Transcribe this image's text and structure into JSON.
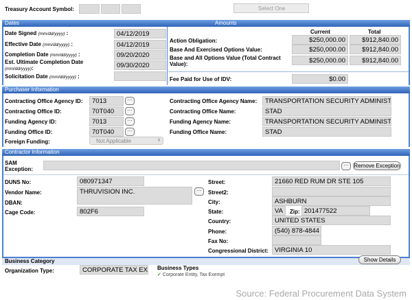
{
  "top": {
    "treasury_label": "Treasury Account Symbol:",
    "select_text": "Select One"
  },
  "dates": {
    "header": "Dates",
    "rows": [
      {
        "label": "Date Signed",
        "fmt": "(mm/dd/yyyy)",
        "suffix": " :",
        "value": "04/12/2019"
      },
      {
        "label": "Effective Date",
        "fmt": "(mm/dd/yyyy)",
        "suffix": " :",
        "value": "04/12/2019"
      },
      {
        "label": "Completion Date",
        "fmt": "(mm/dd/yyyy)",
        "suffix": " :",
        "value": "09/20/2020"
      },
      {
        "label": "Est. Ultimate Completion Date",
        "fmt": "(mm/dd/yyyy)",
        "suffix": ":",
        "value": "09/30/2020"
      },
      {
        "label": "Solicitation Date",
        "fmt": "(mm/dd/yyyy)",
        "suffix": " :",
        "value": ""
      }
    ]
  },
  "amounts": {
    "header": "Amounts",
    "col_current": "Current",
    "col_total": "Total",
    "rows": [
      {
        "label": "Action Obligation:",
        "current": "$250,000.00",
        "total": "$912,840.00"
      },
      {
        "label": "Base And Exercised Options Value:",
        "current": "$250,000.00",
        "total": "$912,840.00"
      },
      {
        "label": "Base and All Options Value (Total Contract Value):",
        "current": "$250,000.00",
        "total": "$912,840.00"
      }
    ],
    "fee_label": "Fee Paid for Use of IDV:",
    "fee_value": "$0.00"
  },
  "purchaser": {
    "header": "Purchaser Information",
    "left": [
      {
        "label": "Contracting Office Agency ID:",
        "value": "7013"
      },
      {
        "label": "Contracting Office ID:",
        "value": "70T040"
      },
      {
        "label": "Funding Agency ID:",
        "value": "7013"
      },
      {
        "label": "Funding Office ID:",
        "value": "70T040"
      }
    ],
    "foreign_label": "Foreign Funding:",
    "foreign_value": "Not Applicable",
    "right": [
      {
        "label": "Contracting Office Agency Name:",
        "value": "TRANSPORTATION SECURITY ADMINISTRA"
      },
      {
        "label": "Contracting Office Name:",
        "value": "STAD"
      },
      {
        "label": "Funding Agency Name:",
        "value": "TRANSPORTATION SECURITY ADMINISTRA"
      },
      {
        "label": "Funding Office Name:",
        "value": "STAD"
      }
    ]
  },
  "contractor": {
    "header": "Contractor Information",
    "sam_label": "SAM Exception:",
    "sam_value": "",
    "remove_exception": "Remove Exception",
    "duns_label": "DUNS No:",
    "duns": "080971347",
    "vendor_label": "Vendor Name:",
    "vendor": "THRUVISION INC.",
    "dban_label": "DBAN:",
    "dban": "",
    "cage_label": "Cage Code:",
    "cage": "802F6",
    "street_label": "Street:",
    "street": "21660 RED RUM DR STE 105",
    "street2_label": "Street2:",
    "street2": "",
    "city_label": "City:",
    "city": "ASHBURN",
    "state_label": "State:",
    "state": "VA",
    "zip_label": "Zip:",
    "zip": "201477522",
    "country_label": "Country:",
    "country": "UNITED STATES",
    "phone_label": "Phone:",
    "phone": "(540) 878-4844",
    "fax_label": "Fax No:",
    "fax": "",
    "district_label": "Congressional District:",
    "district": "VIRGINIA 10"
  },
  "business": {
    "header": "Business Category",
    "show_details": "Show Details",
    "org_label": "Organization Type:",
    "org_value": "CORPORATE TAX EXE",
    "types_label": "Business Types",
    "types_item": "Corporate Entity, Tax Exempt"
  },
  "caption": "Source: Federal Procurement Data System",
  "colors": {
    "header_blue": "#2f63b9",
    "field_grey": "#dcdcdc",
    "check_green": "#1a9a1a"
  }
}
